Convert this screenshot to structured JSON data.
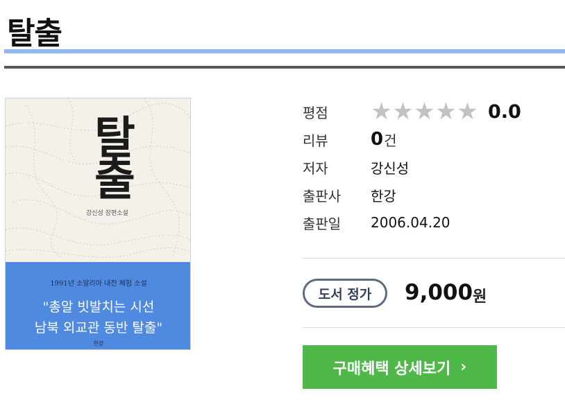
{
  "page_title": "탈출",
  "cover": {
    "title": "탈출",
    "author_line": "강신성 장편소설",
    "band_top": "1991년 소말리아 내전 체험 소설",
    "band_line1": "\"총알 빗발치는 시선",
    "band_line2": "남북 외교관 동반 탈출\"",
    "publisher": "한강"
  },
  "info": {
    "rating_label": "평점",
    "rating_value": "0.0",
    "rating_stars": 0,
    "rating_icon": "star-icon",
    "review_label": "리뷰",
    "review_count": "0",
    "review_unit": "건",
    "author_label": "저자",
    "author": "강신성",
    "publisher_label": "출판사",
    "publisher": "한강",
    "date_label": "출판일",
    "date": "2006.04.20"
  },
  "price": {
    "badge": "도서 정가",
    "value": "9,000",
    "unit": "원"
  },
  "buy_button": {
    "label": "구매혜택 상세보기",
    "icon": "chevron-right-icon",
    "color": "#4fb848"
  },
  "colors": {
    "accent_rule": "#94b4f2",
    "dark_rule": "#55585e",
    "star_inactive": "#c2c2c2"
  }
}
